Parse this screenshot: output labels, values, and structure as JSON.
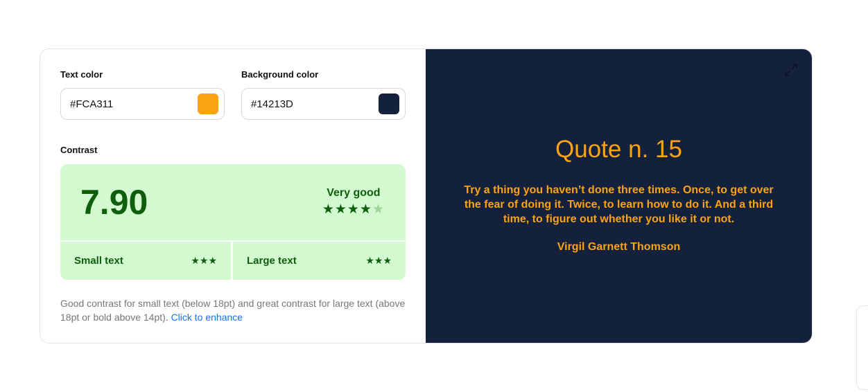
{
  "text_color": {
    "label": "Text color",
    "value": "#FCA311",
    "swatch": "#FCA311"
  },
  "background_color": {
    "label": "Background color",
    "value": "#14213D",
    "swatch": "#14213D"
  },
  "contrast": {
    "label": "Contrast",
    "score": "7.90",
    "rating": "Very good",
    "stars_filled": 4,
    "stars_total": 5,
    "stars": "★★★★",
    "star_off": "★",
    "small_text": {
      "label": "Small text",
      "stars": "★★★"
    },
    "large_text": {
      "label": "Large text",
      "stars": "★★★"
    }
  },
  "note": {
    "text": "Good contrast for small text (below 18pt) and great contrast for large text (above 18pt or bold above 14pt).",
    "link": "Click to enhance"
  },
  "preview": {
    "title": "Quote n. 15",
    "quote": "Try a thing you haven’t done three times. Once, to get over the fear of doing it. Twice, to learn how to do it. And a third time, to figure out whether you like it or not.",
    "author": "Virgil Garnett Thomson"
  }
}
